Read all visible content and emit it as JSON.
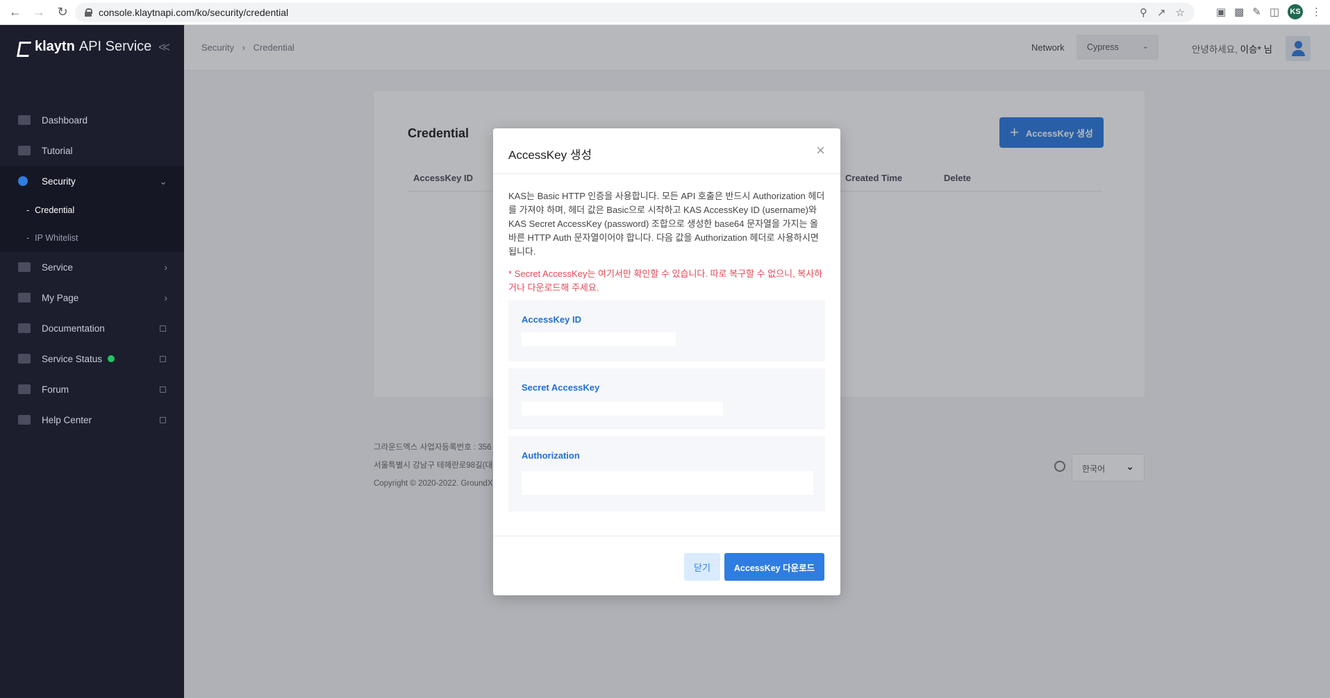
{
  "browser": {
    "url": "console.klaytnapi.com/ko/security/credential",
    "profile_initials": "KS"
  },
  "sidebar": {
    "logo_bold": "klaytn",
    "logo_light": "API Service",
    "items": [
      {
        "label": "Dashboard",
        "icon": "monitor-icon"
      },
      {
        "label": "Tutorial",
        "icon": "video-icon"
      },
      {
        "label": "Security",
        "icon": "key-icon",
        "active": true
      },
      {
        "label": "Service",
        "icon": "grid-icon"
      },
      {
        "label": "My Page",
        "icon": "user-icon"
      },
      {
        "label": "Documentation",
        "icon": "book-icon"
      },
      {
        "label": "Service Status",
        "icon": "sun-icon"
      },
      {
        "label": "Forum",
        "icon": "mail-icon"
      },
      {
        "label": "Help Center",
        "icon": "headset-icon"
      }
    ],
    "security_sub": [
      {
        "label": "Credential",
        "active": true
      },
      {
        "label": "IP Whitelist"
      }
    ]
  },
  "topbar": {
    "breadcrumb": [
      "Security",
      "Credential"
    ],
    "network_label": "Network",
    "network_value": "Cypress",
    "greeting_prefix": "안녕하세요, ",
    "greeting_name": "이승* 님"
  },
  "credential": {
    "title": "Credential",
    "add_button": "AccessKey 생성",
    "columns": [
      "AccessKey ID",
      "Created Time",
      "Delete"
    ]
  },
  "footer": {
    "line1": "그라운드엑스 사업자등록번호 : 356",
    "line2": "서울특별시 강남구 테헤란로98길(대",
    "line3": "Copyright © 2020-2022. GroundX",
    "language": "한국어"
  },
  "modal": {
    "title": "AccessKey 생성",
    "description": "KAS는 Basic HTTP 인증을 사용합니다. 모든 API 호출은 반드시 Authorization 헤더를 가져야 하며, 헤더 값은 Basic으로 시작하고 KAS AccessKey ID (username)와 KAS Secret AccessKey (password) 조합으로 생성한 base64 문자열을 가지는 올바른 HTTP Auth 문자열이어야 합니다. 다음 값을 Authorization 헤더로 사용하시면 됩니다.",
    "warning": "* Secret AccessKey는 여기서만 확인할 수 있습니다. 따로 복구할 수 없으니, 복사하거나 다운로드해 주세요.",
    "field_labels": [
      "AccessKey ID",
      "Secret AccessKey",
      "Authorization"
    ],
    "close_button": "닫기",
    "download_button": "AccessKey 다운로드"
  }
}
